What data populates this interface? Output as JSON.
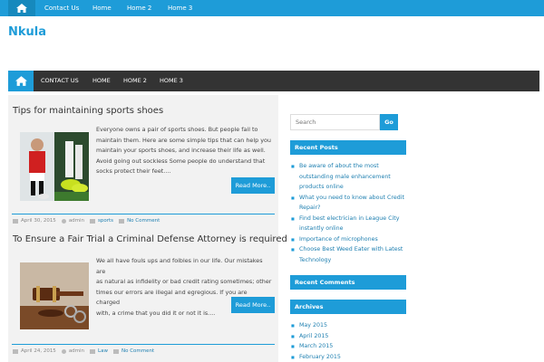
{
  "top_nav": {
    "items": [
      "Contact Us",
      "Home",
      "Home 2",
      "Home 3"
    ]
  },
  "site": {
    "title": "Nkula"
  },
  "main_nav": {
    "items": [
      "CONTACT US",
      "HOME",
      "HOME 2",
      "HOME 3"
    ]
  },
  "posts": [
    {
      "title": "Tips for maintaining sports shoes",
      "excerpt_lines": [
        "Everyone owns a pair of sports shoes. But people fail to",
        "maintain them. Here are some simple tips that can help you",
        "maintain your sports shoes, and increase their life as well.",
        "Avoid going out sockless Some people do understand that",
        "socks protect their feet...."
      ],
      "read_more": "Read More..",
      "date": "April 30, 2015",
      "author": "admin",
      "category": "sports",
      "comments": "No Comment"
    },
    {
      "title": "To Ensure a Fair Trial a Criminal Defense Attorney is required",
      "excerpt_lines": [
        "We all have fouls ups and foibles in our life. Our mistakes are",
        "as natural as infidelity or bad credit rating sometimes; other",
        "times our errors are illegal and egregious. If you are charged",
        "with, a crime that you did it or not it is...."
      ],
      "read_more": "Read More..",
      "date": "April 24, 2015",
      "author": "admin",
      "category": "Law",
      "comments": "No Comment"
    }
  ],
  "search": {
    "placeholder": "Search",
    "button": "Go"
  },
  "recent_posts": {
    "heading": "Recent Posts",
    "items": [
      "Be aware of about the most outstanding male enhancement products online",
      "What you need to know about Credit Repair?",
      "Find best electrician in League City instantly online",
      "Importance of microphones",
      "Choose Best Weed Eater with Latest Technology"
    ]
  },
  "recent_comments": {
    "heading": "Recent Comments"
  },
  "archives": {
    "heading": "Archives",
    "items": [
      "May 2015",
      "April 2015",
      "March 2015",
      "February 2015"
    ]
  },
  "colors": {
    "accent": "#1e9cd8",
    "nav_dark": "#333333",
    "content_bg": "#f2f2f2"
  }
}
